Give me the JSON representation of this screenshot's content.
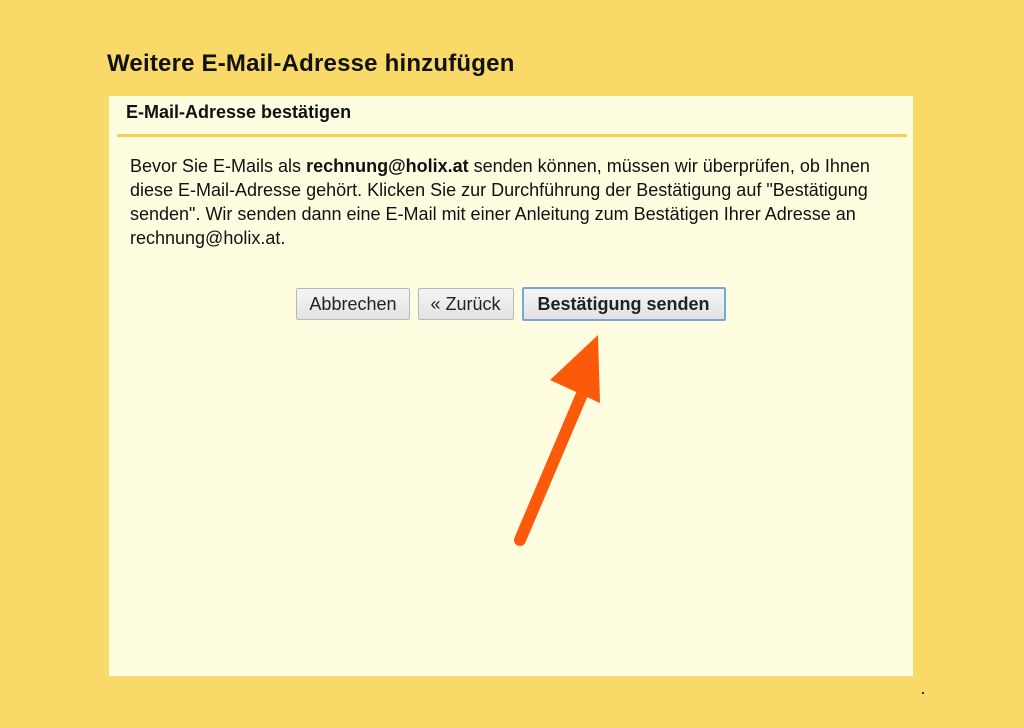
{
  "page": {
    "title": "Weitere E-Mail-Adresse hinzufügen"
  },
  "dialog": {
    "header": "E-Mail-Adresse bestätigen",
    "message_before": "Bevor Sie E-Mails als ",
    "email_bold": "rechnung@holix.at",
    "message_after": " senden können, müssen wir überprüfen, ob Ihnen diese E-Mail-Adresse gehört. Klicken Sie zur Durchführung der Bestätigung auf \"Bestätigung senden\". Wir senden dann eine E-Mail mit einer Anleitung zum Bestätigen Ihrer Adresse an rechnung@holix.at."
  },
  "buttons": {
    "cancel_label": "Abbrechen",
    "back_label": "« Zurück",
    "send_label": "Bestätigung senden"
  },
  "annotation": {
    "arrow_icon": "orange-arrow-icon",
    "arrow_color": "#fa5a0a"
  },
  "colors": {
    "background": "#f9d968",
    "panel": "#fffde0",
    "primary_border": "#7aa3df"
  }
}
